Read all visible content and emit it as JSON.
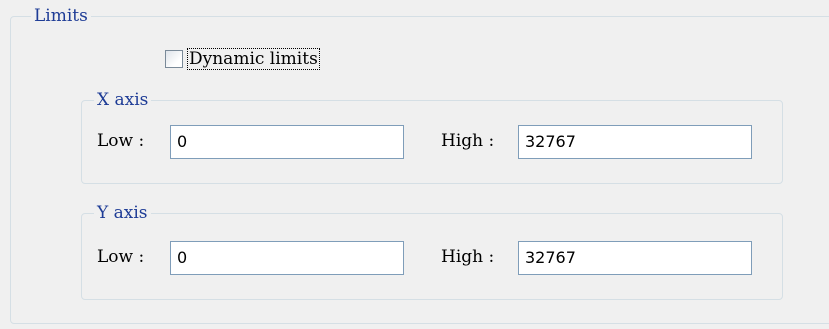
{
  "limits": {
    "title": "Limits",
    "dynamic_limits": {
      "label": "Dynamic limits",
      "checked": false
    },
    "x_axis": {
      "title": "X axis",
      "low_label": "Low :",
      "low_value": "0",
      "high_label": "High :",
      "high_value": "32767"
    },
    "y_axis": {
      "title": "Y axis",
      "low_label": "Low :",
      "low_value": "0",
      "high_label": "High :",
      "high_value": "32767"
    }
  },
  "colors": {
    "legend_text": "#1e3c96",
    "group_border": "#d5dfe5",
    "input_border": "#7f9db9",
    "background": "#f0f0f0"
  }
}
